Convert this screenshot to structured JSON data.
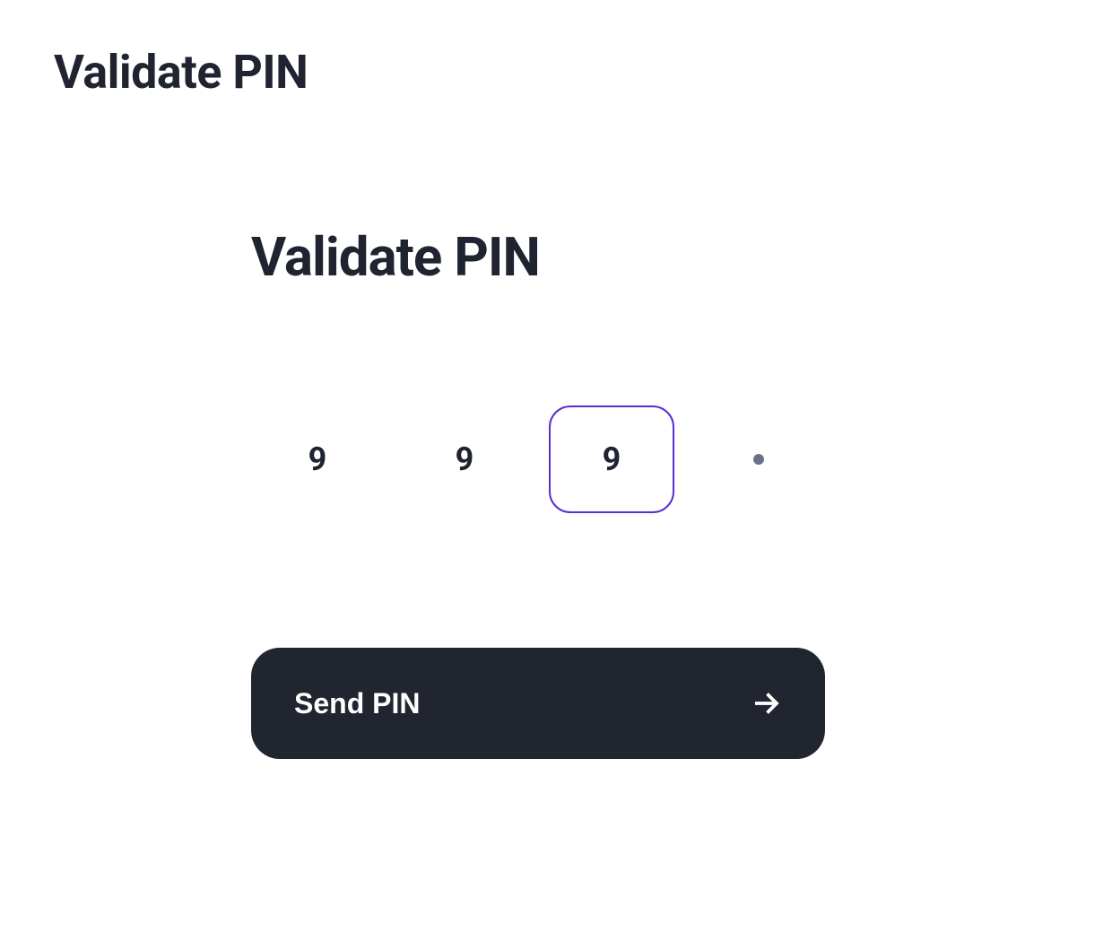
{
  "page": {
    "title": "Validate PIN"
  },
  "main": {
    "heading": "Validate PIN",
    "pin": {
      "digits": [
        "9",
        "9",
        "9",
        ""
      ],
      "focused_index": 2
    },
    "submit": {
      "label": "Send PIN"
    }
  },
  "colors": {
    "text_primary": "#1f2430",
    "accent": "#5b2dd3",
    "button_bg": "#212530",
    "button_fg": "#ffffff",
    "dot": "#6b7089"
  }
}
